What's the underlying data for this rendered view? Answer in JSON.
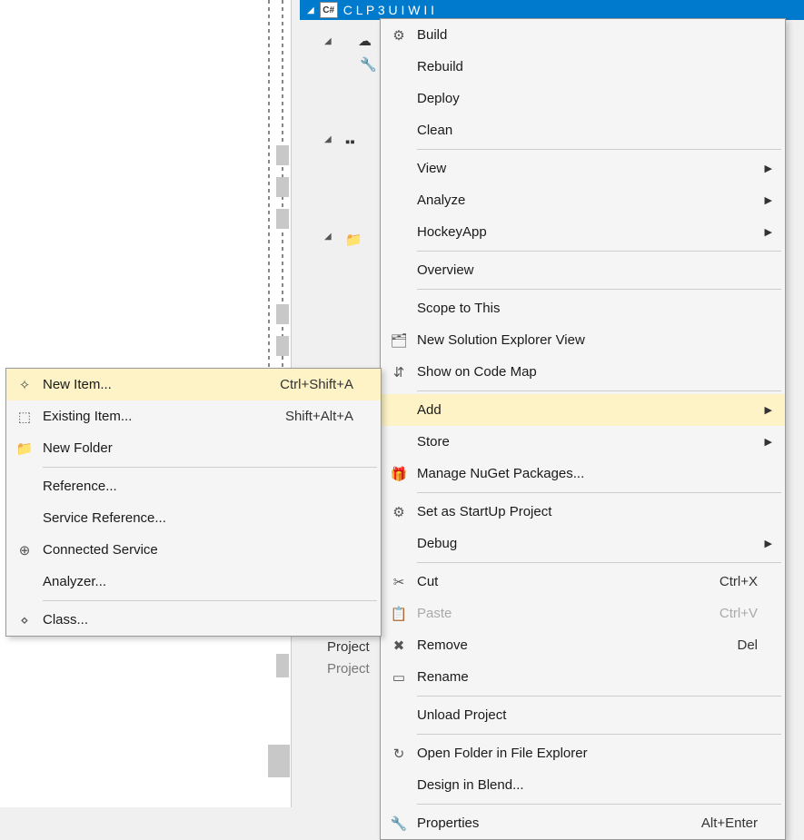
{
  "titleBar": {
    "badge": "C#",
    "text": "C  L  P           3  U   I  W  I     I"
  },
  "backgroundText": {
    "project1": "Project",
    "project2": "Project"
  },
  "mainMenu": [
    {
      "type": "item",
      "icon": "build-icon",
      "label": "Build"
    },
    {
      "type": "item",
      "label": "Rebuild"
    },
    {
      "type": "item",
      "label": "Deploy"
    },
    {
      "type": "item",
      "label": "Clean"
    },
    {
      "type": "sep"
    },
    {
      "type": "item",
      "label": "View",
      "submenu": true
    },
    {
      "type": "item",
      "label": "Analyze",
      "submenu": true
    },
    {
      "type": "item",
      "label": "HockeyApp",
      "submenu": true
    },
    {
      "type": "sep"
    },
    {
      "type": "item",
      "label": "Overview"
    },
    {
      "type": "sep"
    },
    {
      "type": "item",
      "label": "Scope to This"
    },
    {
      "type": "item",
      "icon": "new-view-icon",
      "label": "New Solution Explorer View"
    },
    {
      "type": "item",
      "icon": "codemap-icon",
      "label": "Show on Code Map"
    },
    {
      "type": "sep"
    },
    {
      "type": "item",
      "label": "Add",
      "submenu": true,
      "highlighted": true
    },
    {
      "type": "item",
      "label": "Store",
      "submenu": true
    },
    {
      "type": "item",
      "icon": "nuget-icon",
      "label": "Manage NuGet Packages..."
    },
    {
      "type": "sep"
    },
    {
      "type": "item",
      "icon": "gear-icon",
      "label": "Set as StartUp Project"
    },
    {
      "type": "item",
      "label": "Debug",
      "submenu": true
    },
    {
      "type": "sep"
    },
    {
      "type": "item",
      "icon": "cut-icon",
      "label": "Cut",
      "shortcut": "Ctrl+X"
    },
    {
      "type": "item",
      "icon": "paste-icon",
      "label": "Paste",
      "shortcut": "Ctrl+V",
      "disabled": true
    },
    {
      "type": "item",
      "icon": "remove-icon",
      "label": "Remove",
      "shortcut": "Del"
    },
    {
      "type": "item",
      "icon": "rename-icon",
      "label": "Rename"
    },
    {
      "type": "sep"
    },
    {
      "type": "item",
      "label": "Unload Project"
    },
    {
      "type": "sep"
    },
    {
      "type": "item",
      "icon": "open-folder-icon",
      "label": "Open Folder in File Explorer"
    },
    {
      "type": "item",
      "label": "Design in Blend..."
    },
    {
      "type": "sep"
    },
    {
      "type": "item",
      "icon": "wrench-icon",
      "label": "Properties",
      "shortcut": "Alt+Enter"
    }
  ],
  "subMenu": [
    {
      "type": "item",
      "icon": "new-item-icon",
      "label": "New Item...",
      "shortcut": "Ctrl+Shift+A",
      "highlighted": true
    },
    {
      "type": "item",
      "icon": "existing-item-icon",
      "label": "Existing Item...",
      "shortcut": "Shift+Alt+A"
    },
    {
      "type": "item",
      "icon": "new-folder-icon",
      "label": "New Folder"
    },
    {
      "type": "sep"
    },
    {
      "type": "item",
      "label": "Reference..."
    },
    {
      "type": "item",
      "label": "Service Reference..."
    },
    {
      "type": "item",
      "icon": "connected-service-icon",
      "label": "Connected Service"
    },
    {
      "type": "item",
      "label": "Analyzer..."
    },
    {
      "type": "sep"
    },
    {
      "type": "item",
      "icon": "class-icon",
      "label": "Class..."
    }
  ]
}
